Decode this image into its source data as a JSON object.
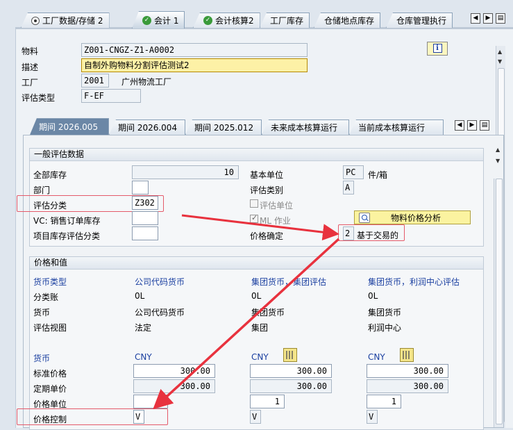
{
  "top_tabs": [
    {
      "label": "工厂数据/存储 2",
      "icon": "radio-icon"
    },
    {
      "label": "会计 1",
      "icon": "check-icon",
      "active": true
    },
    {
      "label": "会计核算2",
      "icon": "check-icon"
    },
    {
      "label": "工厂库存"
    },
    {
      "label": "仓储地点库存"
    },
    {
      "label": "仓库管理执行"
    }
  ],
  "header": {
    "material_label": "物料",
    "material_value": "Z001-CNGZ-Z1-A0002",
    "desc_label": "描述",
    "desc_value": "自制外购物料分割评估测试2",
    "plant_label": "工厂",
    "plant_code": "2001",
    "plant_name": "广州物流工厂",
    "valtype_label": "评估类型",
    "valtype_value": "F-EF"
  },
  "period_tabs": [
    {
      "label": "期间 2026.005",
      "active": true
    },
    {
      "label": "期间 2026.004"
    },
    {
      "label": "期间 2025.012"
    },
    {
      "label": "未来成本核算运行"
    },
    {
      "label": "当前成本核算运行"
    }
  ],
  "general": {
    "title": "一般评估数据",
    "total_stock_label": "全部库存",
    "total_stock_value": "10",
    "base_unit_label": "基本单位",
    "base_unit_value": "PC",
    "base_unit_text": "件/箱",
    "division_label": "部门",
    "val_cat_label": "评估类别",
    "val_cat_value": "A",
    "val_class_label": "评估分类",
    "val_class_value": "Z302",
    "val_unit_label": "评估单位",
    "vc_label": "VC: 销售订单库存",
    "ml_label": "ML 作业",
    "proj_label": "项目库存评估分类",
    "price_btn_label": "物料价格分析",
    "price_det_label": "价格确定",
    "price_det_value": "2",
    "price_det_text": "基于交易的"
  },
  "prices": {
    "title": "价格和值",
    "headers": [
      "货币类型",
      "公司代码货币",
      "集团货币，集团评估",
      "集团货币，利润中心评估"
    ],
    "rows": [
      {
        "label": "分类账",
        "values": [
          "0L",
          "0L",
          "0L"
        ]
      },
      {
        "label": "货币",
        "values": [
          "公司代码货币",
          "集团货币",
          "集团货币"
        ]
      },
      {
        "label": "评估视图",
        "values": [
          "法定",
          "集团",
          "利润中心"
        ]
      }
    ],
    "currency_label": "货币",
    "currencies": [
      "CNY",
      "CNY",
      "CNY"
    ],
    "std_price_label": "标准价格",
    "std_prices": [
      "300.00",
      "300.00",
      "300.00"
    ],
    "per_price_label": "定期单价",
    "per_prices": [
      "300.00",
      "300.00",
      "300.00"
    ],
    "price_unit_label": "价格单位",
    "price_units": [
      "",
      "1",
      "1"
    ],
    "price_ctrl_label": "价格控制",
    "price_ctrls": [
      "V",
      "V",
      "V"
    ]
  },
  "colors": {
    "highlight": "#e45a6a",
    "arrow": "#e8323e",
    "active_tab": "#6b87a6"
  }
}
